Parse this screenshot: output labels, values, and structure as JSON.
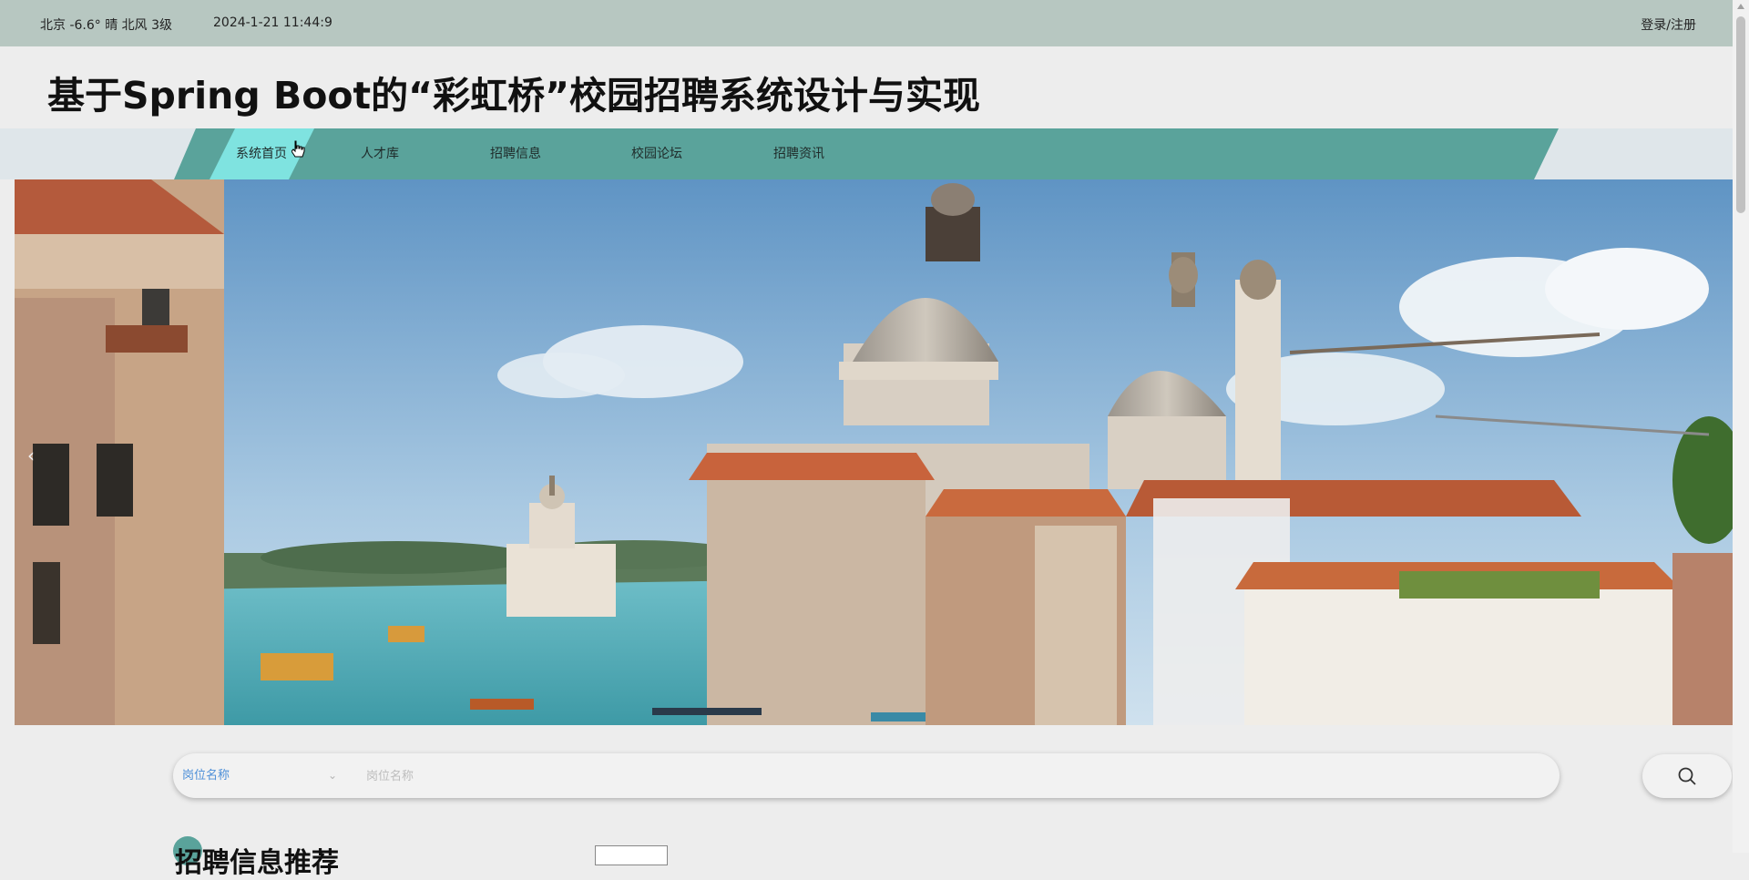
{
  "topbar": {
    "weather": "北京  -6.6°  晴  北风  3级",
    "datetime": "2024-1-21 11:44:9",
    "login": "登录/注册"
  },
  "header": {
    "title": "基于Spring Boot的“彩虹桥”校园招聘系统设计与实现"
  },
  "nav": {
    "items": [
      {
        "label": "系统首页",
        "active": true
      },
      {
        "label": "人才库"
      },
      {
        "label": "招聘信息"
      },
      {
        "label": "校园论坛"
      },
      {
        "label": "招聘资讯"
      }
    ]
  },
  "search": {
    "field_selected": "岗位名称",
    "placeholder": "岗位名称"
  },
  "section": {
    "title": "招聘信息推荐"
  },
  "colors": {
    "topbar": "#b7c7c1",
    "nav": "#5aa39b",
    "nav_active": "#7fe3e0",
    "search_select": "#4d8fd8"
  },
  "icons": [
    "search-icon",
    "chevron-down-icon",
    "chevron-left-icon",
    "cursor-icon"
  ]
}
